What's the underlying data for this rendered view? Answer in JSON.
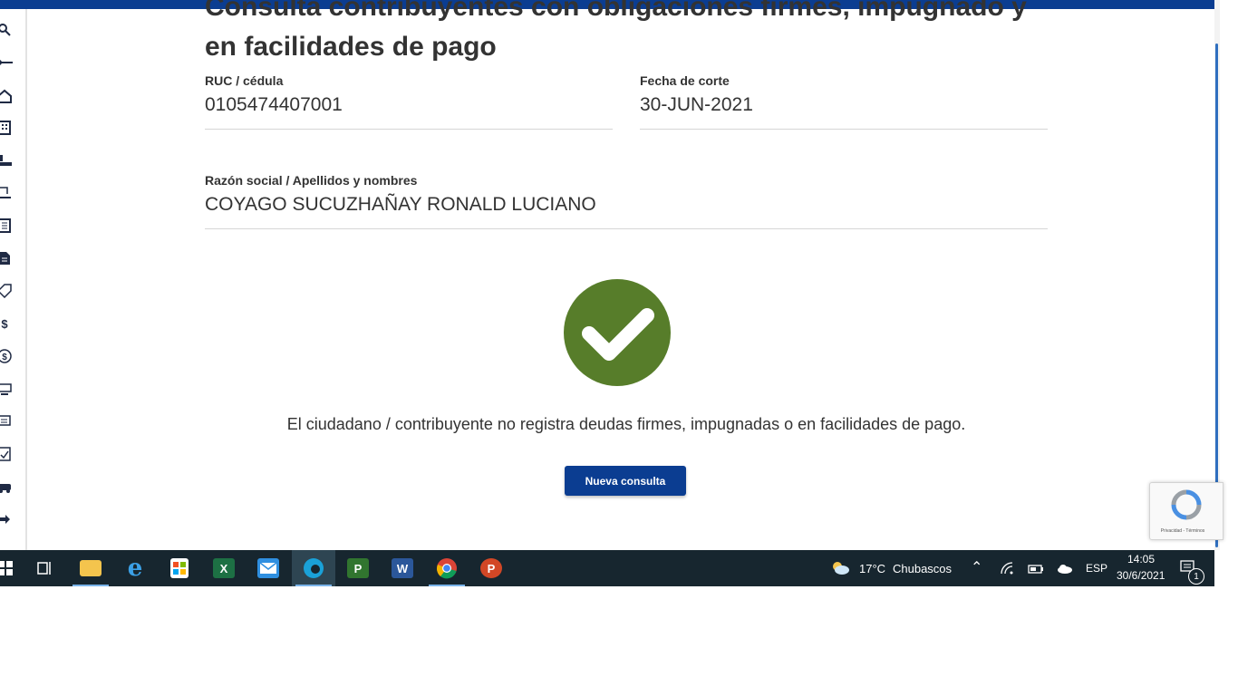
{
  "header": {
    "title_line1": "Consulta contribuyentes con obligaciones firmes, impugnado y",
    "title_line2": "en facilidades de pago"
  },
  "fields": {
    "ruc_label": "RUC / cédula",
    "ruc_value": "0105474407001",
    "fecha_label": "Fecha de corte",
    "fecha_value": "30-JUN-2021",
    "razon_label": "Razón social / Apellidos y nombres",
    "razon_value": "COYAGO SUCUZHAÑAY RONALD LUCIANO"
  },
  "result": {
    "status_icon": "check-circle-icon",
    "message": "El ciudadano / contribuyente no registra deudas firmes, impugnadas o en facilidades de pago.",
    "button_label": "Nueva consulta"
  },
  "recaptcha": {
    "links": "Privacidad - Términos"
  },
  "sidebar": {
    "icons": [
      "search-icon",
      "key-icon",
      "house-icon",
      "building-icon",
      "desk-icon",
      "hand-document-icon",
      "document-list-icon",
      "document-icon",
      "tag-icon",
      "dollar-icon",
      "coin-icon",
      "vehicle-plate-icon",
      "forms-icon",
      "document-check-icon",
      "car-icon",
      "arrow-right-icon"
    ]
  },
  "taskbar": {
    "apps": [
      "windows-start-icon",
      "task-view-icon",
      "file-explorer-icon",
      "internet-explorer-icon",
      "microsoft-store-icon",
      "excel-icon",
      "mail-icon",
      "edge-icon",
      "project-icon",
      "word-icon",
      "chrome-icon",
      "powerpoint-icon"
    ],
    "weather_temp": "17°C",
    "weather_desc": "Chubascos",
    "language": "ESP",
    "time": "14:05",
    "date": "30/6/2021",
    "notifications": "1"
  },
  "colors": {
    "brand_blue": "#0b3d91",
    "success_green": "#577d2a",
    "taskbar_bg": "#17262f"
  }
}
